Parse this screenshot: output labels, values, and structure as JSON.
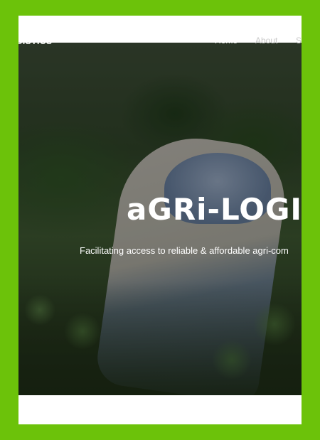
{
  "brand": {
    "name": "GISTICS"
  },
  "nav": {
    "items": [
      {
        "label": "Home",
        "active": true
      },
      {
        "label": "About"
      },
      {
        "label": "S"
      }
    ]
  },
  "hero": {
    "title": "aGRi-LOGI",
    "subtitle": "Facilitating access to reliable & affordable agri-com"
  },
  "colors": {
    "page_background": "#6cc20a",
    "frame_background": "#ffffff",
    "nav_active": "#ffffff",
    "nav_inactive": "#c9c9c9"
  }
}
